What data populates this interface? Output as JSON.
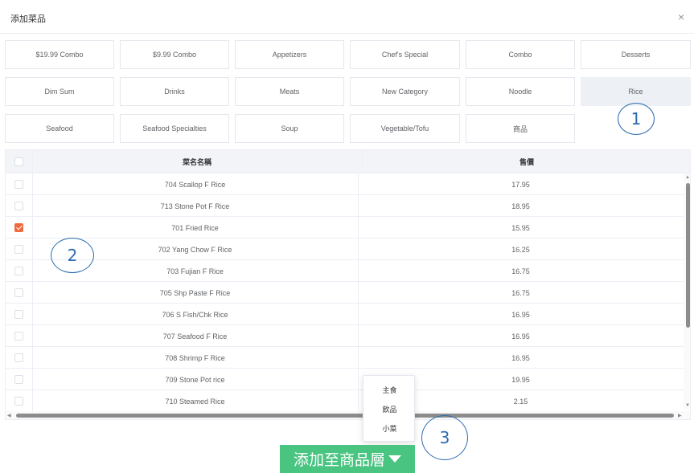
{
  "dialog": {
    "title": "添加菜品",
    "close_label": "×"
  },
  "categories": [
    {
      "label": "$19.99 Combo"
    },
    {
      "label": "$9.99 Combo"
    },
    {
      "label": "Appetizers"
    },
    {
      "label": "Chef's Special"
    },
    {
      "label": "Combo"
    },
    {
      "label": "Desserts"
    },
    {
      "label": "Dim Sum"
    },
    {
      "label": "Drinks"
    },
    {
      "label": "Meats"
    },
    {
      "label": "New Category"
    },
    {
      "label": "Noodle"
    },
    {
      "label": "Rice",
      "active": true
    },
    {
      "label": "Seafood"
    },
    {
      "label": "Seafood Specialties"
    },
    {
      "label": "Soup"
    },
    {
      "label": "Vegetable/Tofu"
    },
    {
      "label": "商品"
    }
  ],
  "table": {
    "columns": [
      {
        "label": "菜名名稱"
      },
      {
        "label": "售價"
      }
    ],
    "rows": [
      {
        "name": "704 Scallop F Rice",
        "price": "17.95",
        "checked": false
      },
      {
        "name": "713 Stone Pot F Rice",
        "price": "18.95",
        "checked": false
      },
      {
        "name": "701 Fried Rice",
        "price": "15.95",
        "checked": true
      },
      {
        "name": "702 Yang Chow F Rice",
        "price": "16.25",
        "checked": false
      },
      {
        "name": "703 Fujian F Rice",
        "price": "16.75",
        "checked": false
      },
      {
        "name": "705 Shp Paste F Rice",
        "price": "16.75",
        "checked": false
      },
      {
        "name": "706 S Fish/Chk Rice",
        "price": "16.95",
        "checked": false
      },
      {
        "name": "707 Seafood F Rice",
        "price": "16.95",
        "checked": false
      },
      {
        "name": "708 Shrimp F Rice",
        "price": "16.95",
        "checked": false
      },
      {
        "name": "709 Stone Pot rice",
        "price": "19.95",
        "checked": false
      },
      {
        "name": "710 Steamed Rice",
        "price": "2.15",
        "checked": false
      }
    ]
  },
  "dropdown": {
    "items": [
      {
        "label": "主食"
      },
      {
        "label": "飲品"
      },
      {
        "label": "小菜"
      }
    ]
  },
  "action": {
    "label": "添加至商品層"
  },
  "annotations": [
    {
      "label": "1"
    },
    {
      "label": "2"
    },
    {
      "label": "3"
    }
  ],
  "colors": {
    "accent": "#49c481",
    "checked": "#f06a3c",
    "annotation": "#2b6cb0",
    "active_category": "#edf0f4"
  }
}
